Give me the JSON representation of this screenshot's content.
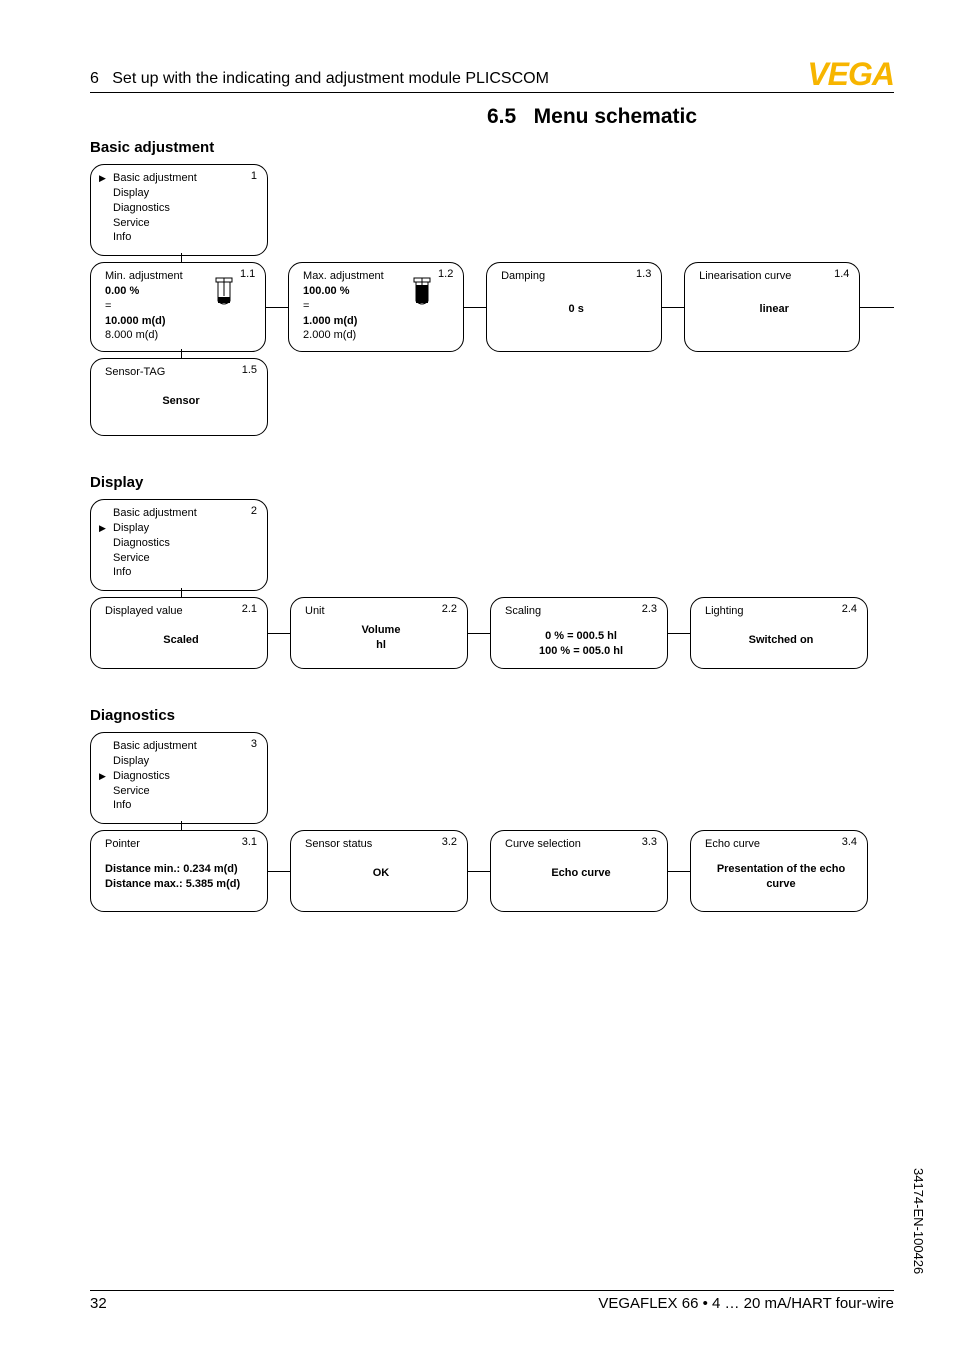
{
  "header": {
    "chapter": "6",
    "title": "Set up with the indicating and adjustment module PLICSCOM",
    "logo": "VEGA"
  },
  "section": {
    "number": "6.5",
    "title": "Menu schematic"
  },
  "groups": {
    "basic": {
      "heading": "Basic adjustment",
      "menu": {
        "num": "1",
        "items": [
          "Basic adjustment",
          "Display",
          "Diagnostics",
          "Service",
          "Info"
        ],
        "selected": 0
      },
      "nodes": [
        {
          "num": "1.1",
          "title": "Min. adjustment",
          "l1": "0.00 %",
          "l2": "=",
          "l3": "10.000 m(d)",
          "l4": "8.000 m(d)",
          "icon": "min"
        },
        {
          "num": "1.2",
          "title": "Max. adjustment",
          "l1": "100.00 %",
          "l2": "=",
          "l3": "1.000 m(d)",
          "l4": "2.000 m(d)",
          "icon": "max"
        },
        {
          "num": "1.3",
          "title": "Damping",
          "value": "0 s"
        },
        {
          "num": "1.4",
          "title": "Linearisation curve",
          "value": "linear"
        }
      ],
      "extra": {
        "num": "1.5",
        "title": "Sensor-TAG",
        "value": "Sensor"
      }
    },
    "display": {
      "heading": "Display",
      "menu": {
        "num": "2",
        "items": [
          "Basic adjustment",
          "Display",
          "Diagnostics",
          "Service",
          "Info"
        ],
        "selected": 1
      },
      "nodes": [
        {
          "num": "2.1",
          "title": "Displayed value",
          "value": "Scaled"
        },
        {
          "num": "2.2",
          "title": "Unit",
          "l1": "Volume",
          "l2": "hl"
        },
        {
          "num": "2.3",
          "title": "Scaling",
          "l1": "0 % = 000.5 hl",
          "l2": "100 % = 005.0 hl"
        },
        {
          "num": "2.4",
          "title": "Lighting",
          "value": "Switched on"
        }
      ]
    },
    "diagnostics": {
      "heading": "Diagnostics",
      "menu": {
        "num": "3",
        "items": [
          "Basic adjustment",
          "Display",
          "Diagnostics",
          "Service",
          "Info"
        ],
        "selected": 2
      },
      "nodes": [
        {
          "num": "3.1",
          "title": "Pointer",
          "l1": "Distance min.: 0.234 m(d)",
          "l2": "Distance max.: 5.385 m(d)"
        },
        {
          "num": "3.2",
          "title": "Sensor status",
          "value": "OK"
        },
        {
          "num": "3.3",
          "title": "Curve selection",
          "value": "Echo curve"
        },
        {
          "num": "3.4",
          "title": "Echo curve",
          "value": "Presentation of the echo curve"
        }
      ]
    }
  },
  "footer": {
    "page": "32",
    "product": "VEGAFLEX 66 • 4 … 20 mA/HART four-wire"
  },
  "doc_code": "34174-EN-100426"
}
